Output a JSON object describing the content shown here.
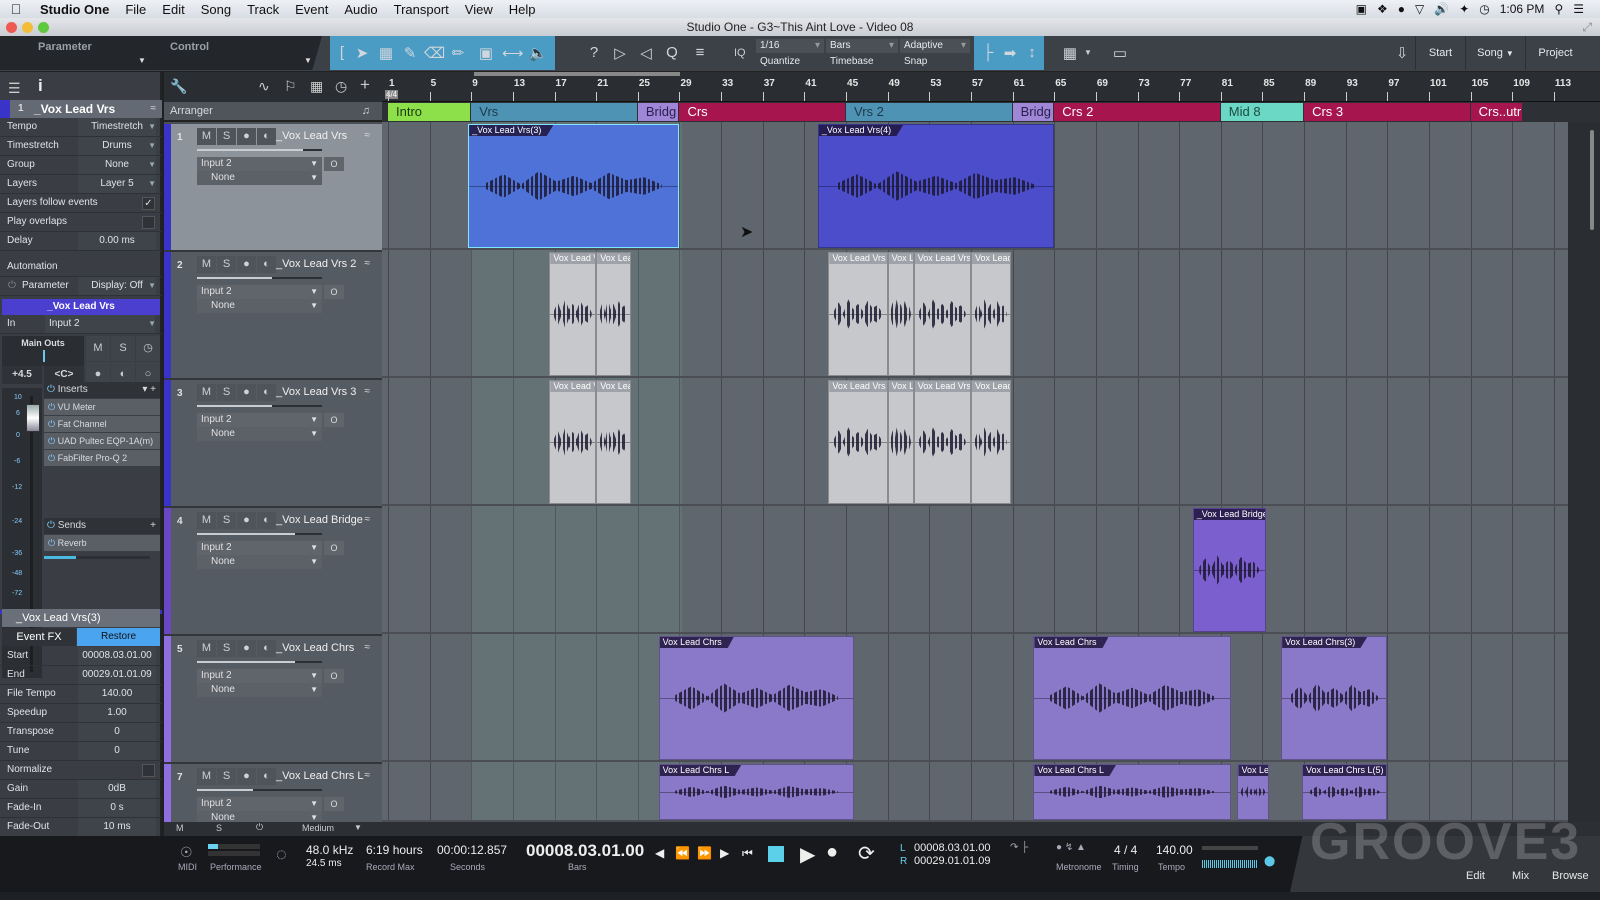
{
  "menubar": {
    "app": "Studio One",
    "items": [
      "File",
      "Edit",
      "Song",
      "Track",
      "Event",
      "Audio",
      "Transport",
      "View",
      "Help"
    ],
    "clock": "1:06 PM"
  },
  "window": {
    "title": "Studio One - G3~This Aint Love - Video 08"
  },
  "toolbar": {
    "parameter_label": "Parameter",
    "control_label": "Control",
    "quantize_value": "1/16",
    "quantize_label": "Quantize",
    "timebase_value": "Bars",
    "timebase_label": "Timebase",
    "snap_value": "Adaptive",
    "snap_label": "Snap",
    "iq_label": "IQ",
    "start_label": "Start",
    "song_label": "Song",
    "project_label": "Project"
  },
  "inspector": {
    "track_num": "1",
    "track_name": "_Vox Lead Vrs",
    "rows": [
      {
        "label": "Tempo",
        "value": "Timestretch"
      },
      {
        "label": "Timestretch",
        "value": "Drums"
      },
      {
        "label": "Group",
        "value": "None"
      },
      {
        "label": "Layers",
        "value": "Layer 5"
      }
    ],
    "layers_follow": "Layers follow events",
    "layers_follow_checked": true,
    "play_overlaps": "Play overlaps",
    "delay_label": "Delay",
    "delay_value": "0.00 ms",
    "automation_label": "Automation",
    "parameter_label": "Parameter",
    "display_value": "Display: Off",
    "channel_name": "_Vox Lead Vrs",
    "in_label": "In",
    "in_value": "Input 2",
    "main_outs": "Main Outs",
    "volume": "+4.5",
    "pan": "<C>",
    "inserts_label": "Inserts",
    "inserts": [
      "VU Meter",
      "Fat Channel",
      "UAD Pultec EQP-1A(m)",
      "FabFilter Pro-Q 2"
    ],
    "sends_label": "Sends",
    "sends": [
      "Reverb"
    ],
    "meter_scale": [
      "10",
      "6",
      "0",
      "-6",
      "-12",
      "-24",
      "-36",
      "-48",
      "-72"
    ],
    "event_name": "_Vox Lead Vrs(3)",
    "event_fx": "Event FX",
    "restore": "Restore",
    "event_rows": [
      {
        "label": "Start",
        "value": "00008.03.01.00"
      },
      {
        "label": "End",
        "value": "00029.01.01.09"
      },
      {
        "label": "File Tempo",
        "value": "140.00"
      },
      {
        "label": "Speedup",
        "value": "1.00"
      },
      {
        "label": "Transpose",
        "value": "0"
      },
      {
        "label": "Tune",
        "value": "0"
      },
      {
        "label": "Normalize",
        "value": ""
      },
      {
        "label": "Gain",
        "value": "0dB"
      },
      {
        "label": "Fade-In",
        "value": "0 s"
      },
      {
        "label": "Fade-Out",
        "value": "10 ms"
      }
    ]
  },
  "ruler": {
    "time_sig": "4/4",
    "bars": [
      "1",
      "5",
      "9",
      "13",
      "17",
      "21",
      "25",
      "29",
      "33",
      "37",
      "41",
      "45",
      "49",
      "53",
      "57",
      "61",
      "65",
      "69",
      "73",
      "77",
      "81",
      "85",
      "89",
      "93",
      "97",
      "101",
      "105",
      "109",
      "113"
    ]
  },
  "arranger": {
    "label": "Arranger",
    "sections": [
      {
        "name": "Intro",
        "start": 1,
        "end": 9,
        "color": "#8ee04a",
        "text": "#1d3a10"
      },
      {
        "name": "Vrs",
        "start": 9,
        "end": 25,
        "color": "#4f93b4",
        "text": "#1d3a4a"
      },
      {
        "name": "Bridg",
        "start": 25,
        "end": 29,
        "color": "#9f86d6",
        "text": "#2a2050"
      },
      {
        "name": "Crs",
        "start": 29,
        "end": 45,
        "color": "#a6154e",
        "text": "#ffffff"
      },
      {
        "name": "Vrs 2",
        "start": 45,
        "end": 61,
        "color": "#4f93b4",
        "text": "#1d3a4a"
      },
      {
        "name": "Bridg",
        "start": 61,
        "end": 65,
        "color": "#9f86d6",
        "text": "#2a2050"
      },
      {
        "name": "Crs 2",
        "start": 65,
        "end": 81,
        "color": "#a6154e",
        "text": "#ffffff"
      },
      {
        "name": "Mid 8",
        "start": 81,
        "end": 89,
        "color": "#6ad8c4",
        "text": "#1d4a40"
      },
      {
        "name": "Crs 3",
        "start": 89,
        "end": 105,
        "color": "#a6154e",
        "text": "#ffffff"
      },
      {
        "name": "Crs..utr",
        "start": 105,
        "end": 110,
        "color": "#a6154e",
        "text": "#ffffff"
      }
    ]
  },
  "tracks": [
    {
      "num": "1",
      "name": "_Vox Lead Vrs",
      "input": "Input 2",
      "output": "None",
      "vol": 0.85,
      "color": "#3a33c9",
      "selected": true
    },
    {
      "num": "2",
      "name": "_Vox Lead Vrs 2",
      "input": "Input 2",
      "output": "None",
      "vol": 0.6,
      "color": "#3a33c9"
    },
    {
      "num": "3",
      "name": "_Vox Lead Vrs 3",
      "input": "Input 2",
      "output": "None",
      "vol": 0.6,
      "color": "#3a33c9"
    },
    {
      "num": "4",
      "name": "_Vox Lead Bridge",
      "input": "Input 2",
      "output": "None",
      "vol": 0.78,
      "color": "#6a48c4"
    },
    {
      "num": "5",
      "name": "_Vox Lead Chrs",
      "input": "Input 2",
      "output": "None",
      "vol": 0.78,
      "color": "#8e6ee0"
    },
    {
      "num": "7",
      "name": "_Vox Lead Chrs L",
      "input": "Input 2",
      "output": "None",
      "vol": 0.45,
      "color": "#8e6ee0"
    }
  ],
  "events": [
    {
      "track": 0,
      "title": "_Vox Lead Vrs(3)",
      "start": 8.7,
      "end": 29,
      "color": "#4f72d8",
      "selected": true
    },
    {
      "track": 0,
      "title": "_Vox Lead Vrs(4)",
      "start": 42.3,
      "end": 65,
      "color": "#4b4dcb"
    },
    {
      "track": 1,
      "title": "Vox Lead V",
      "start": 16.5,
      "end": 21,
      "color": "#c6c8cc",
      "grey": true
    },
    {
      "track": 1,
      "title": "Vox Lea",
      "start": 21,
      "end": 24.3,
      "color": "#c6c8cc",
      "grey": true
    },
    {
      "track": 1,
      "title": "Vox Lead Vrs",
      "start": 43.3,
      "end": 49,
      "color": "#c6c8cc",
      "grey": true
    },
    {
      "track": 1,
      "title": "Vox L",
      "start": 49,
      "end": 51.5,
      "color": "#c6c8cc",
      "grey": true
    },
    {
      "track": 1,
      "title": "Vox Lead Vrs",
      "start": 51.5,
      "end": 57,
      "color": "#c6c8cc",
      "grey": true
    },
    {
      "track": 1,
      "title": "Vox Lead",
      "start": 57,
      "end": 60.8,
      "color": "#c6c8cc",
      "grey": true
    },
    {
      "track": 2,
      "title": "Vox Lead V",
      "start": 16.5,
      "end": 21,
      "color": "#c6c8cc",
      "grey": true
    },
    {
      "track": 2,
      "title": "Vox Lea",
      "start": 21,
      "end": 24.3,
      "color": "#c6c8cc",
      "grey": true
    },
    {
      "track": 2,
      "title": "Vox Lead Vrs",
      "start": 43.3,
      "end": 49,
      "color": "#c6c8cc",
      "grey": true
    },
    {
      "track": 2,
      "title": "Vox L",
      "start": 49,
      "end": 51.5,
      "color": "#c6c8cc",
      "grey": true
    },
    {
      "track": 2,
      "title": "Vox Lead Vrs",
      "start": 51.5,
      "end": 57,
      "color": "#c6c8cc",
      "grey": true
    },
    {
      "track": 2,
      "title": "Vox Lead",
      "start": 57,
      "end": 60.8,
      "color": "#c6c8cc",
      "grey": true
    },
    {
      "track": 3,
      "title": "_Vox Lead Bridge",
      "start": 78.3,
      "end": 85.3,
      "color": "#7b5fcf"
    },
    {
      "track": 4,
      "title": "Vox Lead Chrs",
      "start": 27,
      "end": 45.8,
      "color": "#8a78c8"
    },
    {
      "track": 4,
      "title": "Vox Lead Chrs",
      "start": 63,
      "end": 82,
      "color": "#8a78c8"
    },
    {
      "track": 4,
      "title": "Vox Lead Chrs(3)",
      "start": 86.8,
      "end": 97
    },
    {
      "track": 5,
      "title": "Vox Lead Chrs L",
      "start": 27,
      "end": 45.8,
      "color": "#8a78c8"
    },
    {
      "track": 5,
      "title": "Vox Lead Chrs L",
      "start": 63,
      "end": 82,
      "color": "#8a78c8"
    },
    {
      "track": 5,
      "title": "Vox Le",
      "start": 82.6,
      "end": 85.6,
      "color": "#8a78c8"
    },
    {
      "track": 5,
      "title": "Vox Lead Chrs L(5)",
      "start": 88.8,
      "end": 97,
      "color": "#8a78c8"
    }
  ],
  "trackfoot": {
    "m": "M",
    "s": "S",
    "zoom": "Medium"
  },
  "transport": {
    "midi": "MIDI",
    "performance": "Performance",
    "sample_rate": "48.0 kHz",
    "latency": "24.5 ms",
    "record_max_value": "6:19 hours",
    "record_max_label": "Record Max",
    "seconds_value": "00:00:12.857",
    "seconds_label": "Seconds",
    "bars_value": "00008.03.01.00",
    "bars_label": "Bars",
    "loop_l": "00008.03.01.00",
    "loop_r": "00029.01.01.09",
    "l_label": "L",
    "r_label": "R",
    "metronome_label": "Metronome",
    "timing_value": "4 / 4",
    "timing_label": "Timing",
    "tempo_value": "140.00",
    "tempo_label": "Tempo",
    "edit": "Edit",
    "mix": "Mix",
    "browse": "Browse",
    "watermark": "GROOVE3"
  }
}
